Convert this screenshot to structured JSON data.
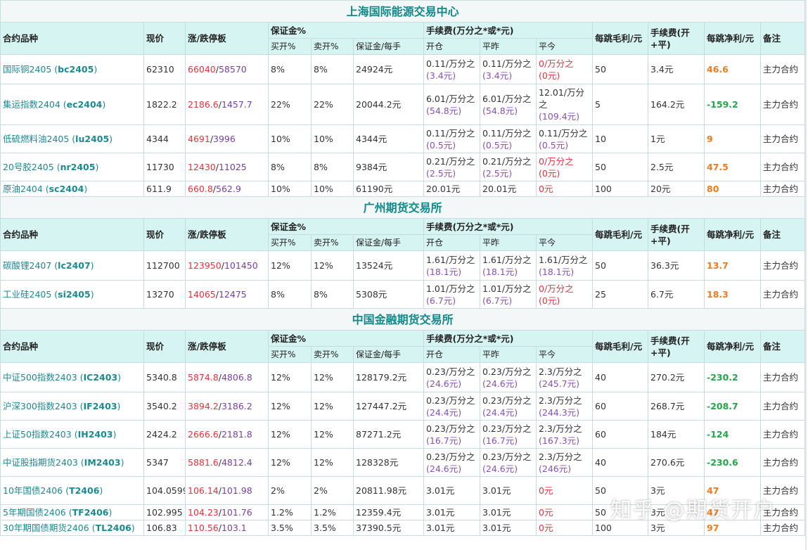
{
  "headers": {
    "name": "合约品种",
    "price": "现价",
    "limit": "涨/跌停板",
    "margin": "保证金%",
    "fee": "手续费(万分之*或*元)",
    "tick_gross": "每跳毛利/元",
    "fee_total": "手续费(开+平)",
    "tick_net": "每跳净利/元",
    "note": "备注",
    "buy": "买开%",
    "sell": "卖开%",
    "per_lot": "保证金/每手",
    "open": "开仓",
    "close_prev": "平昨",
    "close_today": "平今"
  },
  "sections": [
    {
      "title": "上海国际能源交易中心",
      "rows": [
        {
          "name": "国际铜2405",
          "code": "bc2405",
          "price": "62310",
          "up": "66040",
          "down": "58570",
          "buy": "8%",
          "sell": "8%",
          "per_lot": "24924元",
          "open": [
            "0.11/万分之",
            "(3.4元)"
          ],
          "close_prev": [
            "0.11/万分之",
            "(3.4元)"
          ],
          "close_today": [
            "0/万分之",
            "(0元)"
          ],
          "ct_zero": true,
          "gross": "50",
          "fee": "3.4元",
          "net": "46.6",
          "net_sign": "pos",
          "note": "主力合约"
        },
        {
          "name": "集运指数2404",
          "code": "ec2404",
          "price": "1822.2",
          "up": "2186.6",
          "down": "1457.7",
          "buy": "22%",
          "sell": "22%",
          "per_lot": "20044.2元",
          "open": [
            "6.01/万分之",
            "(54.8元)"
          ],
          "close_prev": [
            "6.01/万分之",
            "(54.8元)"
          ],
          "close_today": [
            "12.01/万分",
            "之",
            "(109.4元)"
          ],
          "ct_zero": false,
          "gross": "5",
          "fee": "164.2元",
          "net": "-159.2",
          "net_sign": "neg",
          "note": "主力合约"
        },
        {
          "name": "低硫燃料油2405",
          "code": "lu2405",
          "price": "4344",
          "up": "4691",
          "down": "3996",
          "buy": "10%",
          "sell": "10%",
          "per_lot": "4344元",
          "open": [
            "0.11/万分之",
            "(0.5元)"
          ],
          "close_prev": [
            "0.11/万分之",
            "(0.5元)"
          ],
          "close_today": [
            "0.11/万分之",
            "(0.5元)"
          ],
          "ct_zero": false,
          "gross": "10",
          "fee": "1元",
          "net": "9",
          "net_sign": "pos",
          "note": "主力合约"
        },
        {
          "name": "20号胶2405",
          "code": "nr2405",
          "price": "11730",
          "up": "12430",
          "down": "11025",
          "buy": "8%",
          "sell": "8%",
          "per_lot": "9384元",
          "open": [
            "0.21/万分之",
            "(2.5元)"
          ],
          "close_prev": [
            "0.21/万分之",
            "(2.5元)"
          ],
          "close_today": [
            "0/万分之",
            "(0元)"
          ],
          "ct_zero": true,
          "gross": "50",
          "fee": "2.5元",
          "net": "47.5",
          "net_sign": "pos",
          "note": "主力合约"
        },
        {
          "name": "原油2404",
          "code": "sc2404",
          "price": "611.9",
          "up": "660.8",
          "down": "562.9",
          "buy": "10%",
          "sell": "10%",
          "per_lot": "61190元",
          "open": [
            "20.01元"
          ],
          "close_prev": [
            "20.01元"
          ],
          "close_today": [
            "0元"
          ],
          "ct_zero": true,
          "gross": "100",
          "fee": "20元",
          "net": "80",
          "net_sign": "pos",
          "note": "主力合约"
        }
      ]
    },
    {
      "title": "广州期货交易所",
      "rows": [
        {
          "name": "碳酸锂2407",
          "code": "lc2407",
          "price": "112700",
          "up": "123950",
          "down": "101450",
          "buy": "12%",
          "sell": "12%",
          "per_lot": "13524元",
          "open": [
            "1.61/万分之",
            "(18.1元)"
          ],
          "close_prev": [
            "1.61/万分之",
            "(18.1元)"
          ],
          "close_today": [
            "1.61/万分之",
            "(18.1元)"
          ],
          "ct_zero": false,
          "gross": "50",
          "fee": "36.3元",
          "net": "13.7",
          "net_sign": "pos",
          "note": "主力合约"
        },
        {
          "name": "工业硅2405",
          "code": "si2405",
          "price": "13270",
          "up": "14065",
          "down": "12475",
          "buy": "8%",
          "sell": "8%",
          "per_lot": "5308元",
          "open": [
            "1.01/万分之",
            "(6.7元)"
          ],
          "close_prev": [
            "1.01/万分之",
            "(6.7元)"
          ],
          "close_today": [
            "0/万分之",
            "(0元)"
          ],
          "ct_zero": true,
          "gross": "25",
          "fee": "6.7元",
          "net": "18.3",
          "net_sign": "pos",
          "note": "主力合约"
        }
      ]
    },
    {
      "title": "中国金融期货交易所",
      "rows": [
        {
          "name": "中证500指数2403",
          "code": "IC2403",
          "price": "5340.8",
          "up": "5874.8",
          "down": "4806.8",
          "buy": "12%",
          "sell": "12%",
          "per_lot": "128179.2元",
          "open": [
            "0.23/万分之",
            "(24.6元)"
          ],
          "close_prev": [
            "0.23/万分之",
            "(24.6元)"
          ],
          "close_today": [
            "2.3/万分之",
            "(245.7元)"
          ],
          "ct_zero": false,
          "gross": "40",
          "fee": "270.2元",
          "net": "-230.2",
          "net_sign": "neg",
          "note": "主力合约"
        },
        {
          "name": "沪深300指数2403",
          "code": "IF2403",
          "price": "3540.2",
          "up": "3894.2",
          "down": "3186.2",
          "buy": "12%",
          "sell": "12%",
          "per_lot": "127447.2元",
          "open": [
            "0.23/万分之",
            "(24.4元)"
          ],
          "close_prev": [
            "0.23/万分之",
            "(24.4元)"
          ],
          "close_today": [
            "2.3/万分之",
            "(244.3元)"
          ],
          "ct_zero": false,
          "gross": "60",
          "fee": "268.7元",
          "net": "-208.7",
          "net_sign": "neg",
          "note": "主力合约"
        },
        {
          "name": "上证50指数2403",
          "code": "IH2403",
          "price": "2424.2",
          "up": "2666.6",
          "down": "2181.8",
          "buy": "12%",
          "sell": "12%",
          "per_lot": "87271.2元",
          "open": [
            "0.23/万分之",
            "(16.7元)"
          ],
          "close_prev": [
            "0.23/万分之",
            "(16.7元)"
          ],
          "close_today": [
            "2.3/万分之",
            "(167.3元)"
          ],
          "ct_zero": false,
          "gross": "60",
          "fee": "184元",
          "net": "-124",
          "net_sign": "neg",
          "note": "主力合约"
        },
        {
          "name": "中证股指期货2403",
          "code": "IM2403",
          "price": "5347",
          "up": "5881.6",
          "down": "4812.4",
          "buy": "12%",
          "sell": "12%",
          "per_lot": "128328元",
          "open": [
            "0.23/万分之",
            "(24.6元)"
          ],
          "close_prev": [
            "0.23/万分之",
            "(24.6元)"
          ],
          "close_today": [
            "2.3/万分之",
            "(246元)"
          ],
          "ct_zero": false,
          "gross": "40",
          "fee": "270.6元",
          "net": "-230.6",
          "net_sign": "neg",
          "note": "主力合约"
        },
        {
          "name": "10年国债2406",
          "code": "T2406",
          "price": "104.0599",
          "up": "106.14",
          "down": "101.98",
          "buy": "2%",
          "sell": "2%",
          "per_lot": "20811.98元",
          "open": [
            "3.01元"
          ],
          "close_prev": [
            "3.01元"
          ],
          "close_today": [
            "0元"
          ],
          "ct_zero": true,
          "gross": "50",
          "fee": "3元",
          "net": "47",
          "net_sign": "pos",
          "note": "主力合约"
        },
        {
          "name": "5年期国债2406",
          "code": "TF2406",
          "price": "102.995",
          "up": "104.23",
          "down": "101.76",
          "buy": "1.2%",
          "sell": "1.2%",
          "per_lot": "12359.4元",
          "open": [
            "3.01元"
          ],
          "close_prev": [
            "3.01元"
          ],
          "close_today": [
            "0元"
          ],
          "ct_zero": true,
          "gross": "50",
          "fee": "3元",
          "net": "47",
          "net_sign": "pos",
          "note": "主力合约"
        },
        {
          "name": "30年期国债期货2406",
          "code": "TL2406",
          "price": "106.83",
          "up": "110.56",
          "down": "103.1",
          "buy": "3.5%",
          "sell": "3.5%",
          "per_lot": "37390.5元",
          "open": [
            "3.01元"
          ],
          "close_prev": [
            "3.01元"
          ],
          "close_today": [
            "0元"
          ],
          "ct_zero": true,
          "gross": "100",
          "fee": "3元",
          "net": "97",
          "net_sign": "pos",
          "note": "主力合约"
        }
      ]
    }
  ],
  "watermark": "知乎 @期货开户",
  "colors": {
    "header_bg": "#d6f4f2",
    "title": "#0f8a8a",
    "name": "#1a8a95",
    "limit_up": "#e8313c",
    "limit_down": "#7a3fa5",
    "net_pos": "#f07a1e",
    "net_neg": "#22a64a"
  }
}
